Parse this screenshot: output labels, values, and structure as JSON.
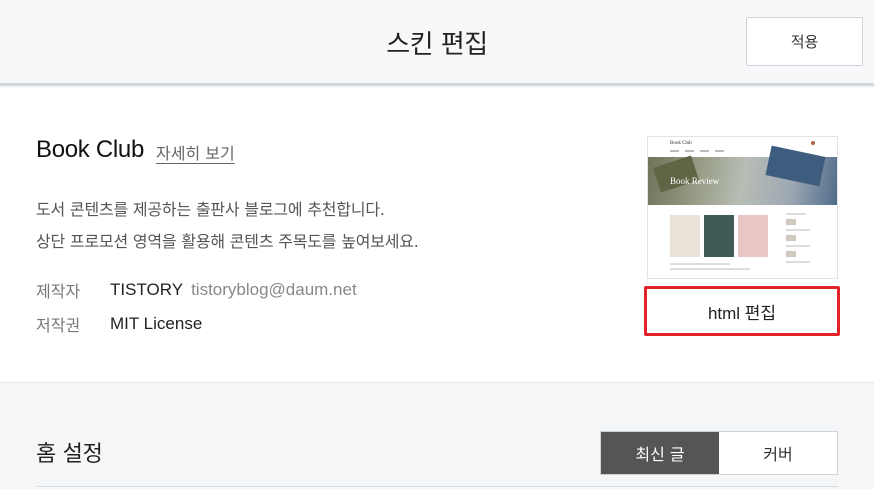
{
  "header": {
    "title": "스킨 편집",
    "apply_label": "적용"
  },
  "skin": {
    "name": "Book Club",
    "detail_link": "자세히 보기",
    "description_line1": "도서 콘텐츠를 제공하는 출판사 블로그에 추천합니다.",
    "description_line2": "상단 프로모션 영역을 활용해 콘텐츠 주목도를 높여보세요.",
    "maker_label": "제작자",
    "maker_value": "TISTORY",
    "maker_email": "tistoryblog@daum.net",
    "license_label": "저작권",
    "license_value": "MIT License",
    "html_edit_label": "html 편집",
    "thumbnail": {
      "logo_text": "Book Club",
      "hero_text": "Book Review"
    }
  },
  "home_settings": {
    "title": "홈 설정",
    "options": [
      {
        "label": "최신 글",
        "active": true
      },
      {
        "label": "커버",
        "active": false
      }
    ]
  },
  "colors": {
    "highlight_border": "#e0242a",
    "active_segment": "#555555"
  }
}
